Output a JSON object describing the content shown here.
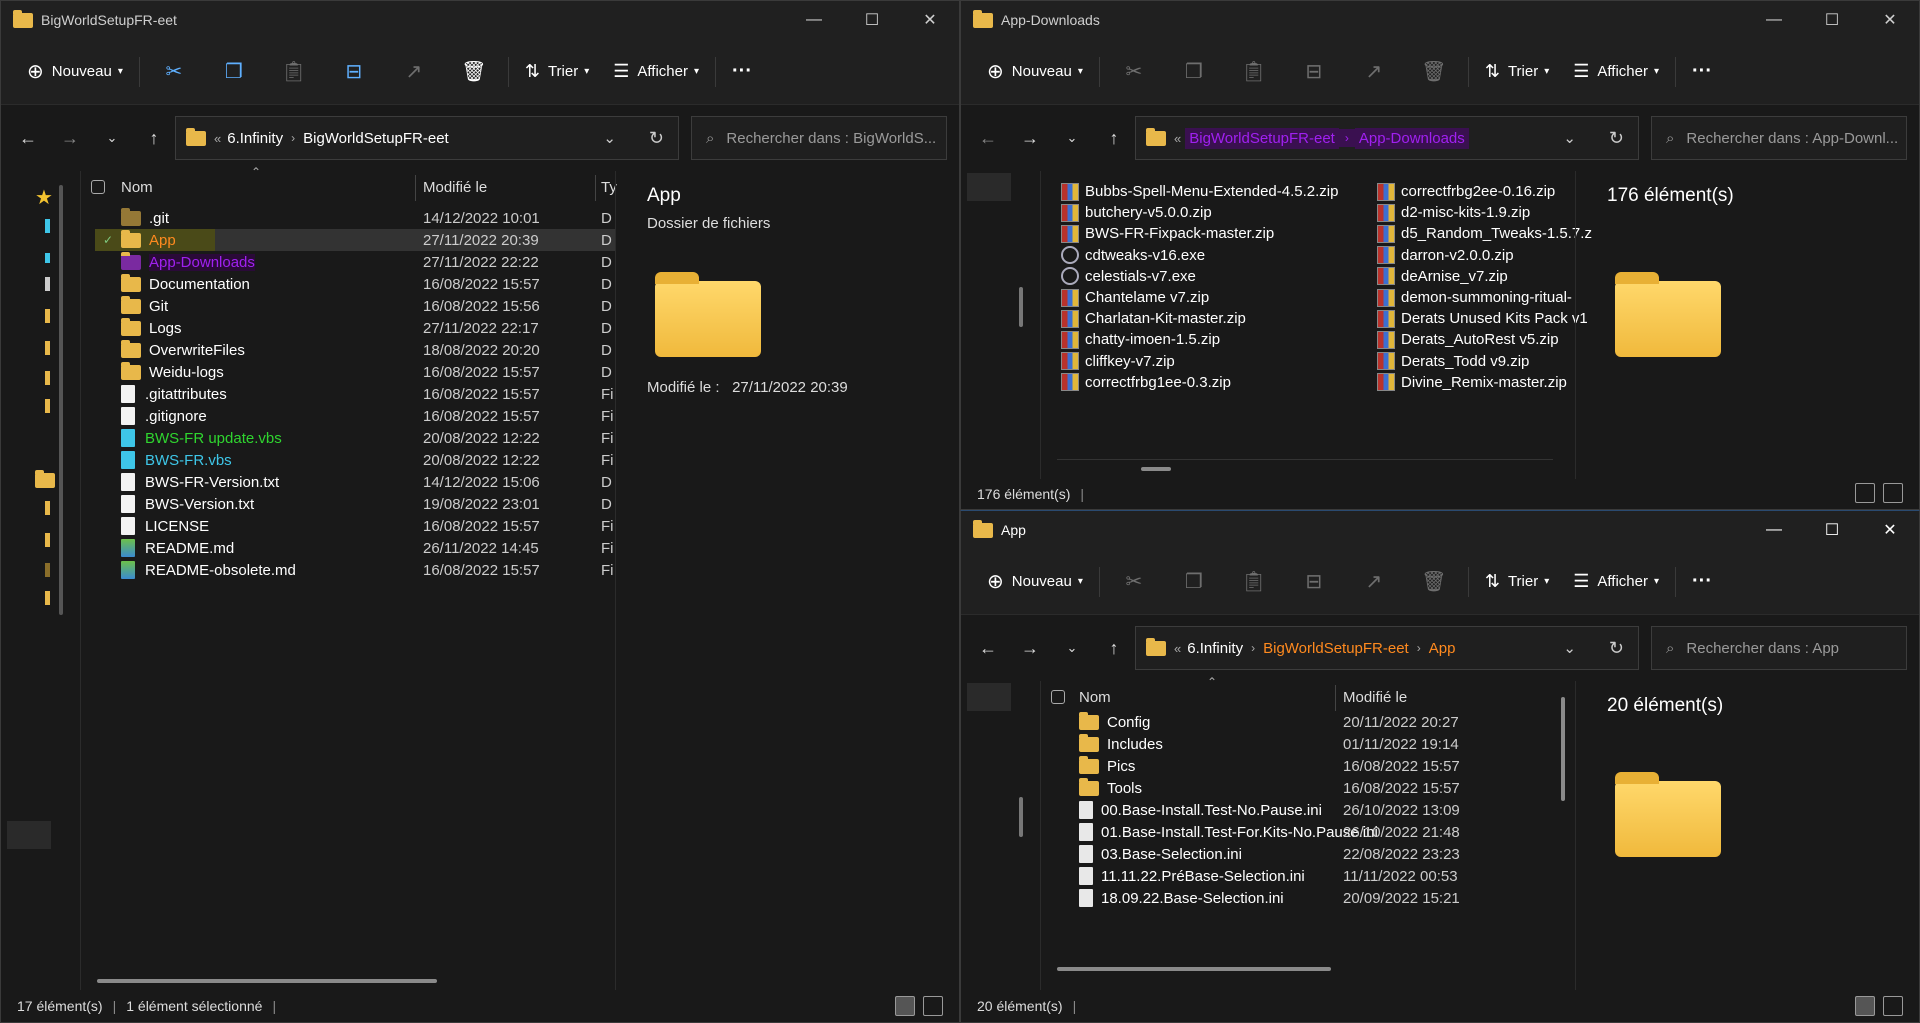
{
  "left": {
    "title": "BigWorldSetupFR-eet",
    "toolbar": {
      "new": "Nouveau",
      "sort": "Trier",
      "view": "Afficher",
      "more": "···"
    },
    "breadcrumb": [
      "6.Infinity",
      "BigWorldSetupFR-eet"
    ],
    "breadcrumb_prefix": "«",
    "search_placeholder": "Rechercher dans : BigWorldS...",
    "columns": {
      "name": "Nom",
      "modified": "Modifié le",
      "type": "Ty"
    },
    "rows": [
      {
        "name": ".git",
        "date": "14/12/2022 10:01",
        "type": "D",
        "icon": "folder-icon"
      },
      {
        "name": "App",
        "date": "27/11/2022 20:39",
        "type": "D",
        "icon": "folder-icon",
        "selected": true
      },
      {
        "name": "App-Downloads",
        "date": "27/11/2022 22:22",
        "type": "D",
        "icon": "folder-icon"
      },
      {
        "name": "Documentation",
        "date": "16/08/2022 15:57",
        "type": "D",
        "icon": "folder-icon"
      },
      {
        "name": "Git",
        "date": "16/08/2022 15:56",
        "type": "D",
        "icon": "folder-icon"
      },
      {
        "name": "Logs",
        "date": "27/11/2022 22:17",
        "type": "D",
        "icon": "folder-icon"
      },
      {
        "name": "OverwriteFiles",
        "date": "18/08/2022 20:20",
        "type": "D",
        "icon": "folder-icon"
      },
      {
        "name": "Weidu-logs",
        "date": "16/08/2022 15:57",
        "type": "D",
        "icon": "folder-icon"
      },
      {
        "name": ".gitattributes",
        "date": "16/08/2022 15:57",
        "type": "Fi",
        "icon": "file-icon"
      },
      {
        "name": ".gitignore",
        "date": "16/08/2022 15:57",
        "type": "Fi",
        "icon": "file-icon"
      },
      {
        "name": "BWS-FR update.vbs",
        "date": "20/08/2022 12:22",
        "type": "Fi",
        "icon": "script-icon"
      },
      {
        "name": "BWS-FR.vbs",
        "date": "20/08/2022 12:22",
        "type": "Fi",
        "icon": "script-icon"
      },
      {
        "name": "BWS-FR-Version.txt",
        "date": "14/12/2022 15:06",
        "type": "D",
        "icon": "file-icon"
      },
      {
        "name": "BWS-Version.txt",
        "date": "19/08/2022 23:01",
        "type": "D",
        "icon": "file-icon"
      },
      {
        "name": "LICENSE",
        "date": "16/08/2022 15:57",
        "type": "Fi",
        "icon": "file-icon"
      },
      {
        "name": "README.md",
        "date": "26/11/2022 14:45",
        "type": "Fi",
        "icon": "image-file-icon"
      },
      {
        "name": "README-obsolete.md",
        "date": "16/08/2022 15:57",
        "type": "Fi",
        "icon": "image-file-icon"
      }
    ],
    "preview": {
      "title": "App",
      "subtitle": "Dossier de fichiers",
      "modified_label": "Modifié le :",
      "modified_value": "27/11/2022 20:39"
    },
    "status": {
      "count": "17 élément(s)",
      "selected": "1 élément sélectionné"
    }
  },
  "topright": {
    "title": "App-Downloads",
    "toolbar": {
      "new": "Nouveau",
      "sort": "Trier",
      "view": "Afficher",
      "more": "···"
    },
    "breadcrumb": [
      "BigWorldSetupFR-eet",
      "App-Downloads"
    ],
    "search_placeholder": "Rechercher dans : App-Downl...",
    "col1": [
      {
        "name": "Bubbs-Spell-Menu-Extended-4.5.2.zip",
        "icon": "zip-icon"
      },
      {
        "name": "butchery-v5.0.0.zip",
        "icon": "zip-icon"
      },
      {
        "name": "BWS-FR-Fixpack-master.zip",
        "icon": "zip-icon"
      },
      {
        "name": "cdtweaks-v16.exe",
        "icon": "exe-icon"
      },
      {
        "name": "celestials-v7.exe",
        "icon": "exe-icon"
      },
      {
        "name": "Chantelame v7.zip",
        "icon": "zip-icon"
      },
      {
        "name": "Charlatan-Kit-master.zip",
        "icon": "zip-icon"
      },
      {
        "name": "chatty-imoen-1.5.zip",
        "icon": "zip-icon"
      },
      {
        "name": "cliffkey-v7.zip",
        "icon": "zip-icon"
      },
      {
        "name": "correctfrbg1ee-0.3.zip",
        "icon": "zip-icon"
      }
    ],
    "col2": [
      {
        "name": "correctfrbg2ee-0.16.zip",
        "icon": "zip-icon"
      },
      {
        "name": "d2-misc-kits-1.9.zip",
        "icon": "zip-icon"
      },
      {
        "name": "d5_Random_Tweaks-1.5.7.z",
        "icon": "zip-icon"
      },
      {
        "name": "darron-v2.0.0.zip",
        "icon": "zip-icon"
      },
      {
        "name": "deArnise_v7.zip",
        "icon": "zip-icon"
      },
      {
        "name": "demon-summoning-ritual-",
        "icon": "zip-icon"
      },
      {
        "name": "Derats Unused Kits Pack v1",
        "icon": "zip-icon"
      },
      {
        "name": "Derats_AutoRest v5.zip",
        "icon": "zip-icon"
      },
      {
        "name": "Derats_Todd v9.zip",
        "icon": "zip-icon"
      },
      {
        "name": "Divine_Remix-master.zip",
        "icon": "zip-icon"
      }
    ],
    "preview": {
      "count": "176 élément(s)"
    },
    "status": {
      "count": "176 élément(s)"
    }
  },
  "bottomright": {
    "title": "App",
    "toolbar": {
      "new": "Nouveau",
      "sort": "Trier",
      "view": "Afficher",
      "more": "···"
    },
    "breadcrumb": [
      "6.Infinity",
      "BigWorldSetupFR-eet",
      "App"
    ],
    "breadcrumb_prefix": "«",
    "search_placeholder": "Rechercher dans : App",
    "columns": {
      "name": "Nom",
      "modified": "Modifié le"
    },
    "rows": [
      {
        "name": "Config",
        "date": "20/11/2022 20:27",
        "icon": "folder-icon"
      },
      {
        "name": "Includes",
        "date": "01/11/2022 19:14",
        "icon": "folder-icon"
      },
      {
        "name": "Pics",
        "date": "16/08/2022 15:57",
        "icon": "folder-icon"
      },
      {
        "name": "Tools",
        "date": "16/08/2022 15:57",
        "icon": "folder-icon"
      },
      {
        "name": "00.Base-Install.Test-No.Pause.ini",
        "date": "26/10/2022 13:09",
        "icon": "ini-icon"
      },
      {
        "name": "01.Base-Install.Test-For.Kits-No.Pause.ini",
        "date": "26/10/2022 21:48",
        "icon": "ini-icon"
      },
      {
        "name": "03.Base-Selection.ini",
        "date": "22/08/2022 23:23",
        "icon": "ini-icon"
      },
      {
        "name": "11.11.22.PréBase-Selection.ini",
        "date": "11/11/2022 00:53",
        "icon": "ini-icon"
      },
      {
        "name": "18.09.22.Base-Selection.ini",
        "date": "20/09/2022 15:21",
        "icon": "ini-icon"
      }
    ],
    "preview": {
      "count": "20 élément(s)"
    },
    "status": {
      "count": "20 élément(s)"
    }
  },
  "colors": {
    "accent_orange": "#ff8a1f",
    "accent_purple": "#a020f0",
    "green": "#2fd52f",
    "cyan": "#3ec6e8"
  }
}
